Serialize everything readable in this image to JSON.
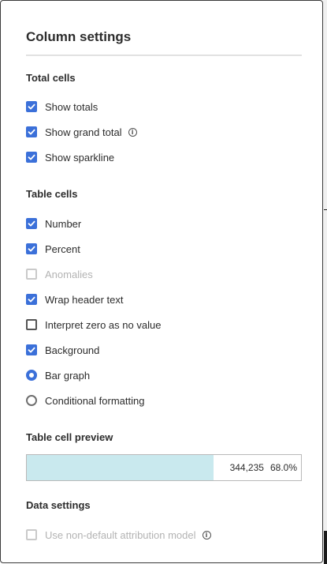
{
  "panel": {
    "title": "Column settings"
  },
  "total_cells": {
    "heading": "Total cells",
    "options": [
      {
        "label": "Show totals",
        "checked": true
      },
      {
        "label": "Show grand total",
        "checked": true,
        "info_icon": "info-icon"
      },
      {
        "label": "Show sparkline",
        "checked": true
      }
    ]
  },
  "table_cells": {
    "heading": "Table cells",
    "options": [
      {
        "label": "Number",
        "checked": true
      },
      {
        "label": "Percent",
        "checked": true
      },
      {
        "label": "Anomalies",
        "checked": false,
        "disabled": true
      },
      {
        "label": "Wrap header text",
        "checked": true
      },
      {
        "label": "Interpret zero as no value",
        "checked": false
      },
      {
        "label": "Background",
        "checked": true
      }
    ],
    "background_style": {
      "options": [
        {
          "label": "Bar graph",
          "selected": true
        },
        {
          "label": "Conditional formatting",
          "selected": false
        }
      ]
    }
  },
  "preview": {
    "heading": "Table cell preview",
    "value": "344,235",
    "percent": "68.0%",
    "bar_fraction": 0.68,
    "bar_color": "#c9e9ee"
  },
  "data_settings": {
    "heading": "Data settings",
    "options": [
      {
        "label": "Use non-default attribution model",
        "checked": false,
        "disabled": true,
        "info_icon": "info-icon"
      }
    ]
  },
  "colors": {
    "accent": "#3b70d9",
    "text": "#2c2c2c",
    "disabled_text": "#b3b3b3"
  }
}
